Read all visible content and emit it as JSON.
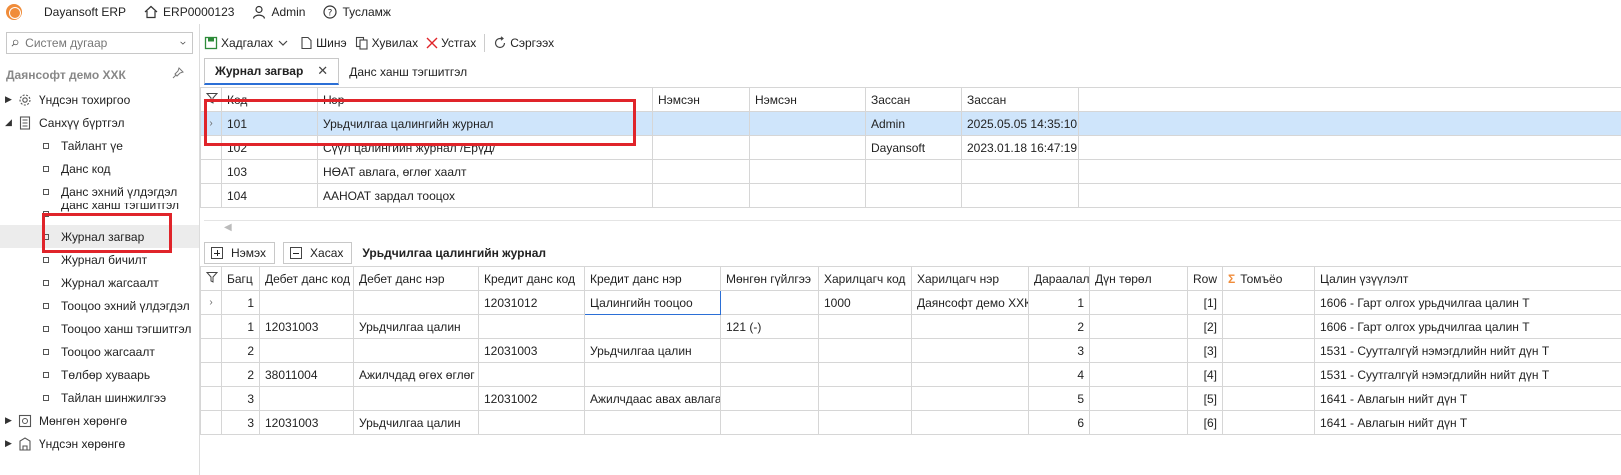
{
  "topbar": {
    "app_name": "Dayansoft ERP",
    "company_code": "ERP0000123",
    "user": "Admin",
    "help": "Тусламж"
  },
  "sidebar": {
    "search_placeholder": "Систем дугаар",
    "org_title": "Даянсофт демо ХХК",
    "items": [
      {
        "label": "Үндсэн тохиргоо",
        "level": 0,
        "arrow": "▶"
      },
      {
        "label": "Санхүү бүртгэл",
        "level": 0,
        "arrow": "◢"
      },
      {
        "label": "Тайлант үе",
        "level": 1
      },
      {
        "label": "Данс код",
        "level": 1
      },
      {
        "label": "Данс эхний үлдэгдэл",
        "level": 1
      },
      {
        "label": "Данс ханш тэгшитгэл",
        "level": 1
      },
      {
        "label": "Журнал загвар",
        "level": 1
      },
      {
        "label": "Журнал бичилт",
        "level": 1
      },
      {
        "label": "Журнал жагсаалт",
        "level": 1
      },
      {
        "label": "Тооцоо эхний үлдэгдэл",
        "level": 1
      },
      {
        "label": "Тооцоо ханш тэгшитгэл",
        "level": 1
      },
      {
        "label": "Тооцоо жагсаалт",
        "level": 1
      },
      {
        "label": "Төлбөр хуваарь",
        "level": 1
      },
      {
        "label": "Тайлан шинжилгээ",
        "level": 1
      },
      {
        "label": "Мөнгөн хөрөнгө",
        "level": 0,
        "arrow": "▶"
      },
      {
        "label": "Үндсэн хөрөнгө",
        "level": 0,
        "arrow": "▶"
      }
    ]
  },
  "toolbar": {
    "save": "Хадгалах",
    "new": "Шинэ",
    "copy": "Хувилах",
    "delete": "Устгах",
    "refresh": "Сэргээх"
  },
  "tabs": [
    {
      "label": "Журнал загвар",
      "active": true
    },
    {
      "label": "Данс ханш тэгшитгэл",
      "active": false
    }
  ],
  "master_grid": {
    "headers": [
      "Код",
      "Нэр",
      "Нэмсэн",
      "Нэмсэн",
      "Зассан",
      "Зассан"
    ],
    "rows": [
      [
        "101",
        "Урьдчилгаа цалингийн журнал",
        "",
        "",
        "Admin",
        "2025.05.05 14:35:10"
      ],
      [
        "102",
        "Сүүл цалингийн журнал /ЕрүД/",
        "",
        "",
        "Dayansoft",
        "2023.01.18 16:47:19"
      ],
      [
        "103",
        "НӨАТ авлага, өглөг хаалт",
        "",
        "",
        "",
        ""
      ],
      [
        "104",
        "ААНОАТ зардал тооцох",
        "",
        "",
        "",
        ""
      ]
    ]
  },
  "detail": {
    "add": "Нэмэх",
    "remove": "Хасах",
    "title": "Урьдчилгаа цалингийн журнал"
  },
  "detail_grid": {
    "headers": [
      "Багц",
      "Дебет данс код",
      "Дебет данс нэр",
      "Кредит данс код",
      "Кредит данс нэр",
      "Мөнгөн гүйлгээ",
      "Харилцагч код",
      "Харилцагч нэр",
      "Дараалал",
      "Дүн төрөл",
      "Row",
      "Томъёо",
      "Цалин үзүүлэлт"
    ],
    "rows": [
      [
        "1",
        "",
        "",
        "12031012",
        "Цалингийн тооцоо",
        "",
        "1000",
        "Даянсофт демо ХХК",
        "1",
        "",
        "[1]",
        "",
        "1606 - Гарт олгох урьдчилгаа цалин Т"
      ],
      [
        "1",
        "12031003",
        "Урьдчилгаа цалин",
        "",
        "",
        "121 (-)",
        "",
        "",
        "2",
        "",
        "[2]",
        "",
        "1606 - Гарт олгох урьдчилгаа цалин Т"
      ],
      [
        "2",
        "",
        "",
        "12031003",
        "Урьдчилгаа цалин",
        "",
        "",
        "",
        "3",
        "",
        "[3]",
        "",
        "1531 - Суутгалгүй нэмэгдлийн нийт дүн Т"
      ],
      [
        "2",
        "38011004",
        "Ажилчдад өгөх өглөг",
        "",
        "",
        "",
        "",
        "",
        "4",
        "",
        "[4]",
        "",
        "1531 - Суутгалгүй нэмэгдлийн нийт дүн Т"
      ],
      [
        "3",
        "",
        "",
        "12031002",
        "Ажилчдаас авах авлага",
        "",
        "",
        "",
        "5",
        "",
        "[5]",
        "",
        "1641 - Авлагын нийт дүн Т"
      ],
      [
        "3",
        "12031003",
        "Урьдчилгаа цалин",
        "",
        "",
        "",
        "",
        "",
        "6",
        "",
        "[6]",
        "",
        "1641 - Авлагын нийт дүн Т"
      ]
    ]
  },
  "colors": {
    "accent": "#2b6fd6",
    "selection": "#cfe5fb",
    "annotation": "#e0242a"
  }
}
